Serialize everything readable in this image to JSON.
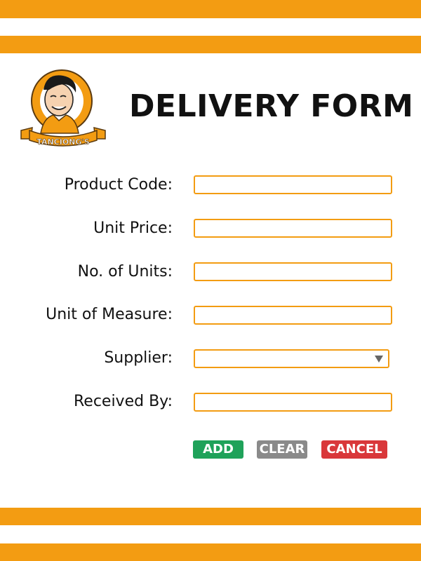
{
  "header": {
    "title": "DELIVERY FORM",
    "logo_text": "TANCIONG'S"
  },
  "form": {
    "fields": [
      {
        "label": "Product Code:",
        "value": "",
        "type": "text"
      },
      {
        "label": "Unit Price:",
        "value": "",
        "type": "text"
      },
      {
        "label": "No. of Units:",
        "value": "",
        "type": "text"
      },
      {
        "label": "Unit of Measure:",
        "value": "",
        "type": "text"
      },
      {
        "label": "Supplier:",
        "value": "",
        "type": "select"
      },
      {
        "label": "Received By:",
        "value": "",
        "type": "text"
      }
    ]
  },
  "buttons": {
    "add": "ADD",
    "clear": "CLEAR",
    "cancel": "CANCEL"
  },
  "colors": {
    "accent": "#f39c12",
    "add": "#1fa25a",
    "clear": "#8a8a8a",
    "cancel": "#d9373a"
  },
  "icons": {
    "dropdown": "chevron-down-icon"
  }
}
